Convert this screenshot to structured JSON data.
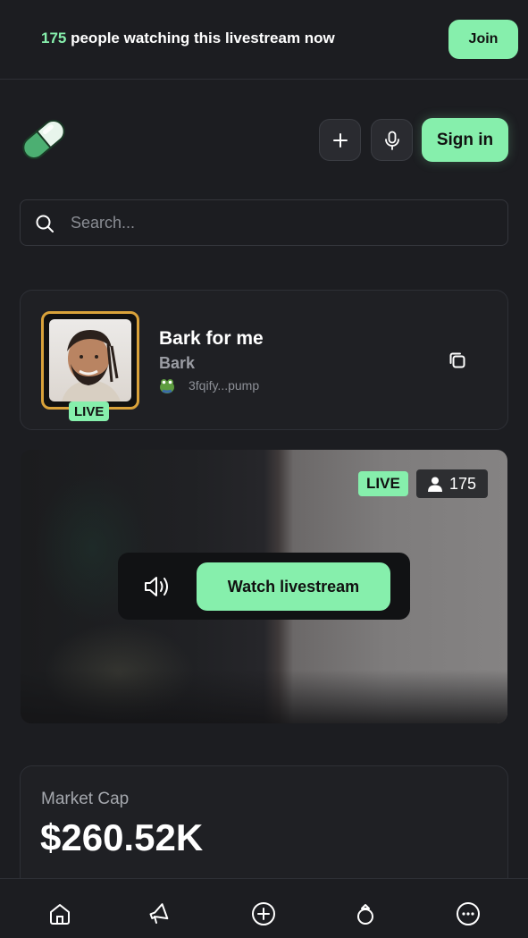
{
  "banner": {
    "viewer_count": "175",
    "text": " people watching this livestream now",
    "join_label": "Join"
  },
  "header": {
    "logo_icon": "pill-logo-icon",
    "create_icon": "plus-icon",
    "voice_icon": "microphone-icon",
    "signin_label": "Sign in"
  },
  "search": {
    "placeholder": "Search...",
    "value": ""
  },
  "token": {
    "name": "Bark for me",
    "ticker": "Bark",
    "address": "3fqify...pump",
    "live_badge": "LIVE",
    "avatar_icon": "streamer-avatar",
    "creator_icon": "frog-avatar-icon",
    "copy_icon": "copy-icon"
  },
  "stream": {
    "live_badge": "LIVE",
    "viewers": "175",
    "sound_icon": "speaker-icon",
    "watch_label": "Watch livestream"
  },
  "market": {
    "label": "Market Cap",
    "value": "$260.52K"
  },
  "nav": {
    "items": [
      "home-icon",
      "megaphone-icon",
      "plus-circle-icon",
      "ring-icon",
      "more-icon"
    ]
  },
  "colors": {
    "accent": "#86efac",
    "background": "#1c1d21",
    "card": "#1f2024",
    "avatar_border": "#d9a23a"
  }
}
